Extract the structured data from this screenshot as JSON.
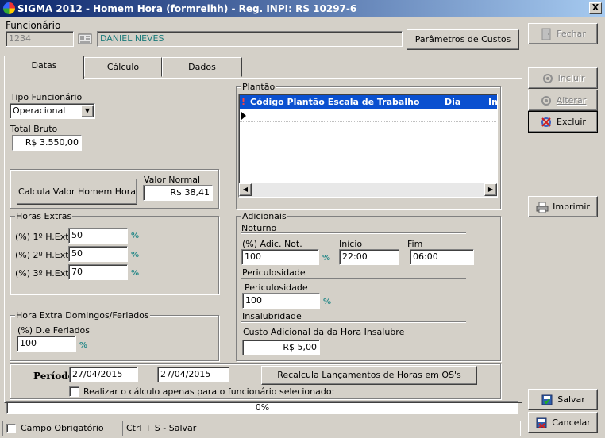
{
  "window": {
    "title": "SIGMA 2012 - Homem Hora  (formrelhh)  - Reg. INPI: RS 10297-6",
    "close": "X"
  },
  "funcionario": {
    "label": "Funcionário",
    "code": "1234",
    "name": "DANIEL NEVES"
  },
  "buttons": {
    "parametros": "Parâmetros de Custos",
    "calcula": "Calcula Valor Homem Hora",
    "recalcula": "Recalcula Lançamentos de Horas em OS's"
  },
  "side": {
    "fechar": "Fechar",
    "incluir": "Incluir",
    "alterar": "Alterar",
    "excluir": "Excluir",
    "imprimir": "Imprimir",
    "salvar": "Salvar",
    "cancelar": "Cancelar"
  },
  "tabs": [
    "Datas",
    "Cálculo",
    "Dados"
  ],
  "tipo": {
    "label": "Tipo Funcionário",
    "value": "Operacional"
  },
  "total": {
    "label": "Total Bruto",
    "value": "R$ 3.550,00"
  },
  "valor_normal": {
    "label": "Valor Normal",
    "value": "R$ 38,41"
  },
  "horas_extras": {
    "legend": "Horas Extras",
    "rows": [
      {
        "label": "(%) 1º H.Ext.",
        "value": "50"
      },
      {
        "label": "(%) 2º H.Ext.",
        "value": "50"
      },
      {
        "label": "(%) 3º H.Ext.",
        "value": "70"
      }
    ],
    "pct": "%"
  },
  "domingos": {
    "legend": "Hora Extra Domingos/Feriados",
    "label": "(%) D.e Feriados",
    "value": "100"
  },
  "plantao": {
    "legend": "Plantão",
    "marker": "!",
    "columns": [
      "Código Plantão Escala de Trabalho",
      "Dia",
      "In"
    ]
  },
  "adicionais": {
    "legend": "Adicionais",
    "noturno": "Noturno",
    "adic_not": {
      "label": "(%) Adic. Not.",
      "value": "100"
    },
    "inicio": {
      "label": "Início",
      "value": "22:00"
    },
    "fim": {
      "label": "Fim",
      "value": "06:00"
    },
    "periculosidade_header": "Periculosidade",
    "periculosidade": {
      "label": "Periculosidade",
      "value": "100"
    },
    "insalubridade_header": "Insalubridade",
    "custo": {
      "label": "Custo Adicional da da Hora Insalubre",
      "value": "R$ 5,00"
    }
  },
  "periodo": {
    "label": "Período",
    "start": "27/04/2015",
    "end": "27/04/2015"
  },
  "checkbox": {
    "label": "Realizar o cálculo apenas para o funcionário selecionado:"
  },
  "progress": {
    "text": "0%",
    "value": 0
  },
  "status": {
    "obrigatorio": "Campo Obrigatório",
    "shortcut": "Ctrl + S - Salvar"
  }
}
